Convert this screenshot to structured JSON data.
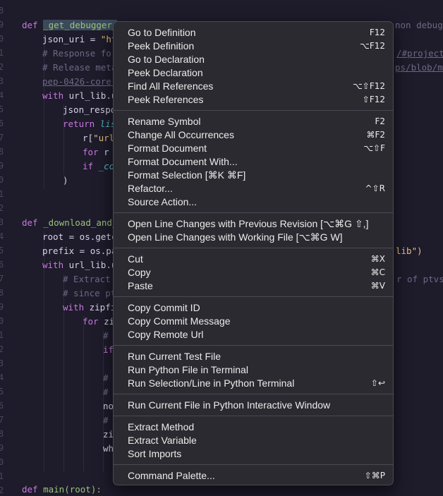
{
  "editor": {
    "line_numbers": [
      "8",
      "9",
      "0",
      "1",
      "2",
      "3",
      "4",
      "5",
      "6",
      "7",
      "8",
      "9",
      "0",
      "1",
      "2",
      "3",
      "4",
      "5",
      "6",
      "7",
      "8",
      "9",
      "0",
      "1",
      "2",
      "3",
      "4",
      "5",
      "6",
      "7",
      "8",
      "9",
      "0",
      "1",
      "2"
    ],
    "lines": {
      "l1_def": "def",
      "l1_fn": "_get_debugger_",
      "l1_right": "non debug",
      "l2_pre": "json_uri = ",
      "l2_str": "\"ht",
      "l3": "# Response for",
      "l3_right": "/#project",
      "l4": "# Release meta",
      "l4_right": "ps/blob/ma",
      "l5": "pep-0426-core-",
      "l6_kw": "with",
      "l6_rest": " url_lib.u",
      "l7": "json_respo",
      "l8_kw": "return",
      "l8_it": " lis",
      "l9_pre": "r[",
      "l9_str": "\"url",
      "l10_kw": "for",
      "l10_rest": " r ",
      "l11_kw": "if",
      "l11_rest": " _co",
      "l12": ")",
      "l14_def": "def",
      "l14_fn": "_download_and_",
      "l15_pre": "root = os.getc",
      "l16_pre": "prefix = os.pa",
      "l16_right": "lib\")",
      "l17_kw": "with",
      "l17_rest": " url_lib.u",
      "l18": "# Extract ",
      "l18_right": "r of ptvs",
      "l19": "# since pt",
      "l20_kw": "with",
      "l20_rest": " zipfi",
      "l21_kw": "for",
      "l21_rest": " zi",
      "l22": "#",
      "l23_kw": "if",
      "l25": "#",
      "l26": "#",
      "l27": "no",
      "l28": "#",
      "l29": "zi",
      "l30": "wh",
      "l33_kw": "def",
      "l33_rest": " main(root):"
    }
  },
  "menu": {
    "groups": [
      [
        {
          "label": "Go to Definition",
          "shortcut": "F12"
        },
        {
          "label": "Peek Definition",
          "shortcut": "⌥F12"
        },
        {
          "label": "Go to Declaration",
          "shortcut": ""
        },
        {
          "label": "Peek Declaration",
          "shortcut": ""
        },
        {
          "label": "Find All References",
          "shortcut": "⌥⇧F12"
        },
        {
          "label": "Peek References",
          "shortcut": "⇧F12"
        }
      ],
      [
        {
          "label": "Rename Symbol",
          "shortcut": "F2"
        },
        {
          "label": "Change All Occurrences",
          "shortcut": "⌘F2"
        },
        {
          "label": "Format Document",
          "shortcut": "⌥⇧F"
        },
        {
          "label": "Format Document With...",
          "shortcut": ""
        },
        {
          "label": "Format Selection [⌘K ⌘F]",
          "shortcut": ""
        },
        {
          "label": "Refactor...",
          "shortcut": "^⇧R"
        },
        {
          "label": "Source Action...",
          "shortcut": ""
        }
      ],
      [
        {
          "label": "Open Line Changes with Previous Revision [⌥⌘G ⇧,]",
          "shortcut": ""
        },
        {
          "label": "Open Line Changes with Working File [⌥⌘G W]",
          "shortcut": ""
        }
      ],
      [
        {
          "label": "Cut",
          "shortcut": "⌘X"
        },
        {
          "label": "Copy",
          "shortcut": "⌘C"
        },
        {
          "label": "Paste",
          "shortcut": "⌘V"
        }
      ],
      [
        {
          "label": "Copy Commit ID",
          "shortcut": ""
        },
        {
          "label": "Copy Commit Message",
          "shortcut": ""
        },
        {
          "label": "Copy Remote Url",
          "shortcut": ""
        }
      ],
      [
        {
          "label": "Run Current Test File",
          "shortcut": ""
        },
        {
          "label": "Run Python File in Terminal",
          "shortcut": ""
        },
        {
          "label": "Run Selection/Line in Python Terminal",
          "shortcut": "⇧↩"
        }
      ],
      [
        {
          "label": "Run Current File in Python Interactive Window",
          "shortcut": ""
        }
      ],
      [
        {
          "label": "Extract Method",
          "shortcut": ""
        },
        {
          "label": "Extract Variable",
          "shortcut": ""
        },
        {
          "label": "Sort Imports",
          "shortcut": ""
        }
      ],
      [
        {
          "label": "Command Palette...",
          "shortcut": "⇧⌘P"
        }
      ]
    ]
  },
  "colors": {
    "editor_bg": "#1e1b2b",
    "menu_bg": "#2b2a30",
    "keyword": "#c678dd",
    "function": "#98c379",
    "string": "#e5c07b",
    "comment": "#6c6a85"
  }
}
